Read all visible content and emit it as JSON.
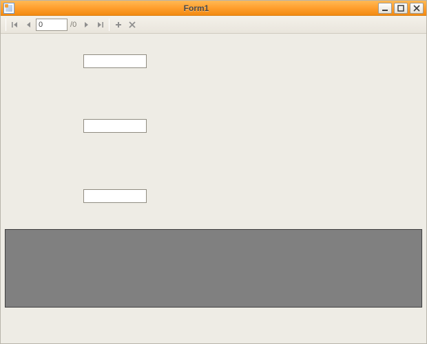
{
  "window": {
    "title": "Form1"
  },
  "navigator": {
    "position": "0",
    "count_prefix": "/",
    "count": "0"
  },
  "fields": {
    "textbox1": "",
    "textbox2": "",
    "textbox3": ""
  }
}
